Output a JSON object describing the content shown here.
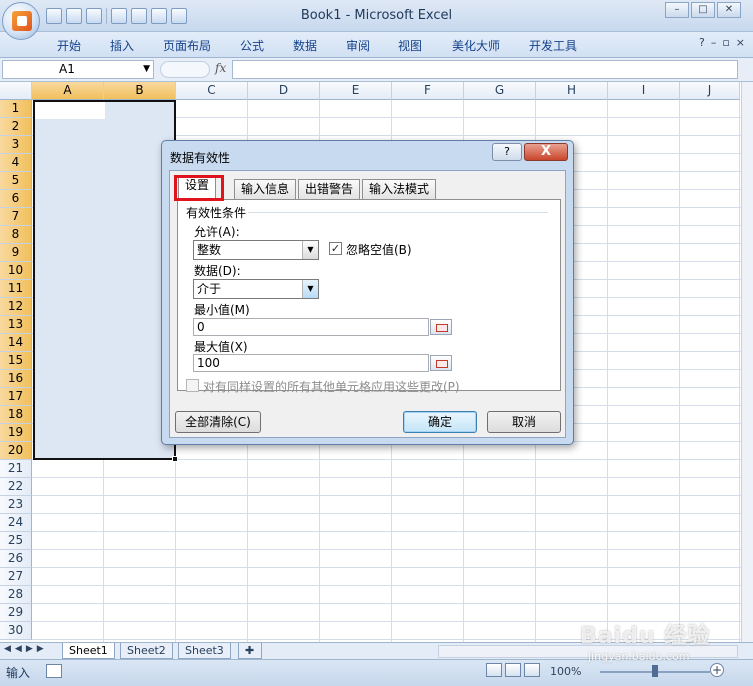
{
  "window": {
    "title": "Book1 - Microsoft Excel"
  },
  "ribbon": {
    "tabs": [
      "开始",
      "插入",
      "页面布局",
      "公式",
      "数据",
      "审阅",
      "视图",
      "美化大师",
      "开发工具"
    ]
  },
  "formula_bar": {
    "name_box": "A1",
    "fx_label": "fx",
    "content": ""
  },
  "columns": [
    "A",
    "B",
    "C",
    "D",
    "E",
    "F",
    "G",
    "H",
    "I",
    "J"
  ],
  "rows": [
    "1",
    "2",
    "3",
    "4",
    "5",
    "6",
    "7",
    "8",
    "9",
    "10",
    "11",
    "12",
    "13",
    "14",
    "15",
    "16",
    "17",
    "18",
    "19",
    "20",
    "21",
    "22",
    "23",
    "24",
    "25",
    "26",
    "27",
    "28",
    "29",
    "30"
  ],
  "selection": {
    "range_cols": [
      "A",
      "B"
    ],
    "range_rows": [
      "1",
      "20"
    ]
  },
  "sheets": [
    "Sheet1",
    "Sheet2",
    "Sheet3"
  ],
  "status": {
    "mode": "输入",
    "zoom": "100%"
  },
  "dialog": {
    "title": "数据有效性",
    "help_label": "?",
    "close_label": "X",
    "tabs": [
      "设置",
      "输入信息",
      "出错警告",
      "输入法模式"
    ],
    "active_tab": "设置",
    "section_label": "有效性条件",
    "allow_label": "允许(A):",
    "allow_value": "整数",
    "ignore_blank_label": "忽略空值(B)",
    "ignore_blank_checked": true,
    "data_label": "数据(D):",
    "data_value": "介于",
    "min_label": "最小值(M)",
    "min_value": "0",
    "max_label": "最大值(X)",
    "max_value": "100",
    "apply_all_label": "对有同样设置的所有其他单元格应用这些更改(P)",
    "apply_all_checked": false,
    "clear_all_label": "全部清除(C)",
    "ok_label": "确定",
    "cancel_label": "取消"
  },
  "watermark": {
    "brand": "Baidu 经验",
    "url": "jingyan.baidu.com"
  },
  "colors": {
    "selection": "#dde6f3",
    "highlight": "#e0141c",
    "header_selected": "#f1c05c"
  }
}
